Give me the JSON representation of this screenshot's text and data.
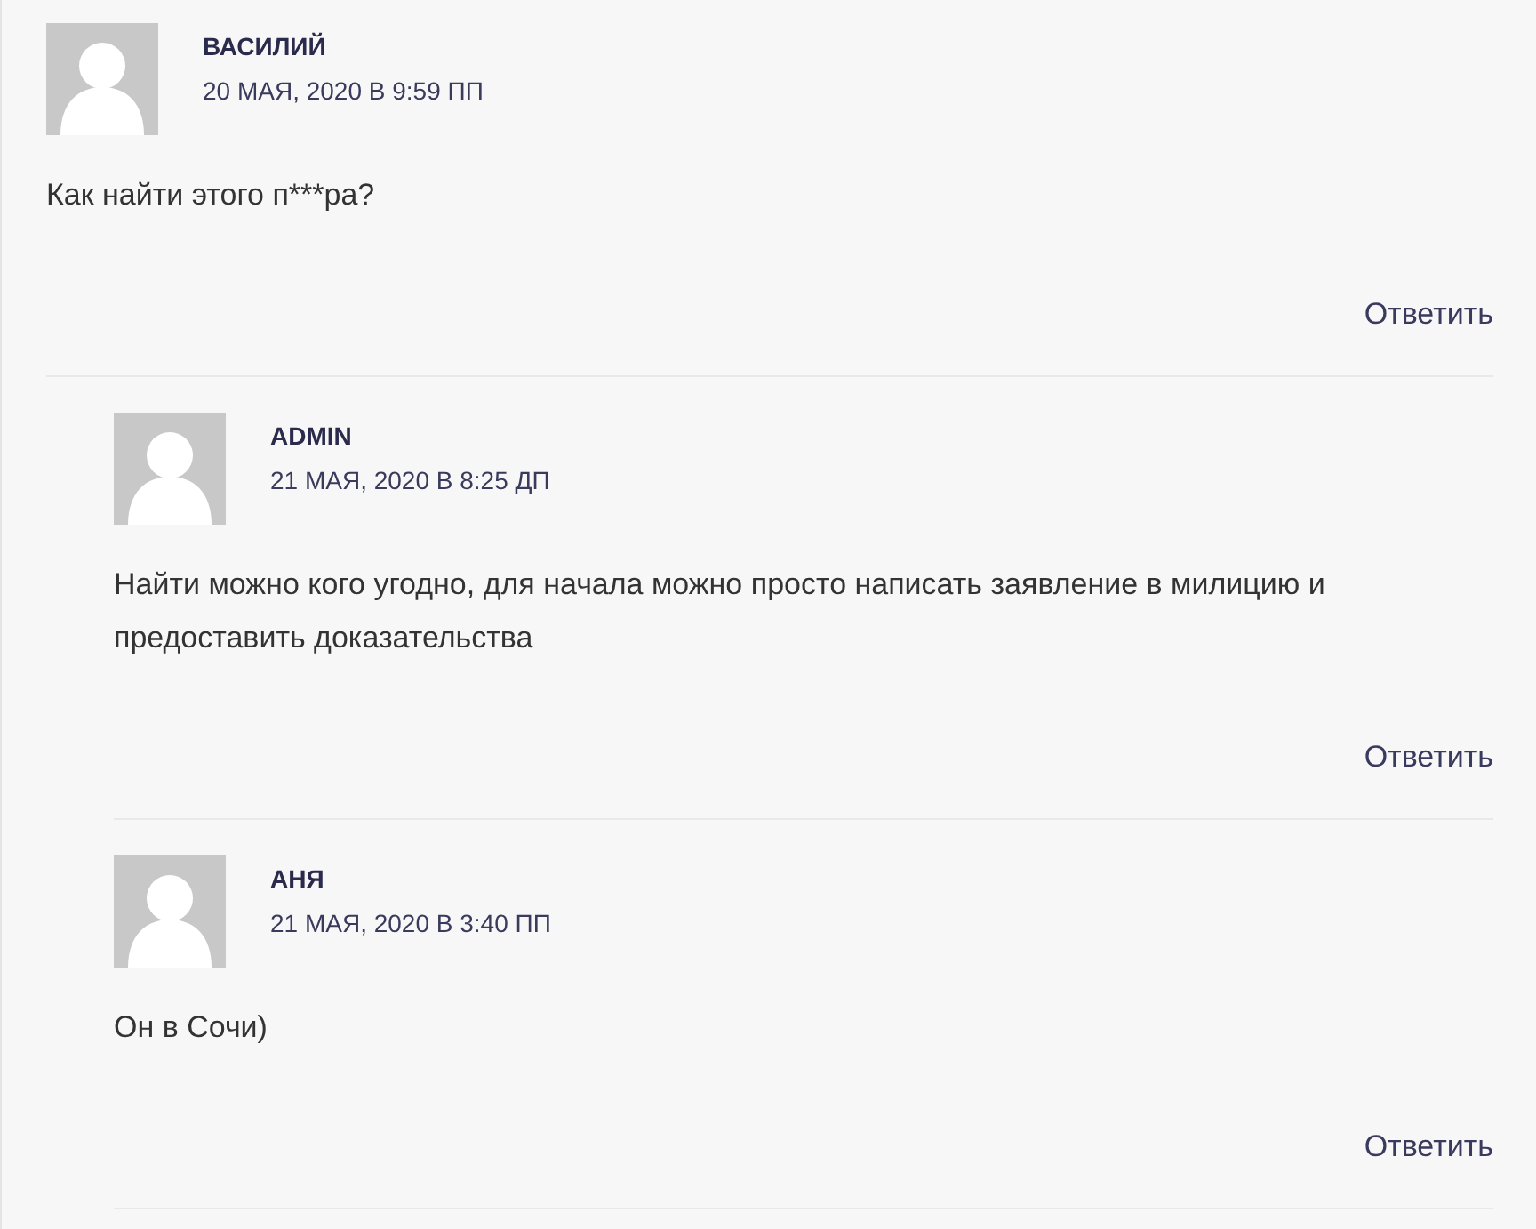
{
  "comments": [
    {
      "author": "ВАСИЛИЙ",
      "date": "20 МАЯ, 2020 В 9:59 ПП",
      "text": "Как найти этого п***ра?",
      "reply": "Ответить",
      "children": [
        {
          "author": "ADMIN",
          "date": "21 МАЯ, 2020 В 8:25 ДП",
          "text": "Найти можно кого угодно, для начала можно просто написать заявление в милицию и предоставить доказательства",
          "reply": "Ответить"
        },
        {
          "author": "АНЯ",
          "date": "21 МАЯ, 2020 В 3:40 ПП",
          "text": "Он в Сочи)",
          "reply": "Ответить"
        }
      ]
    }
  ]
}
